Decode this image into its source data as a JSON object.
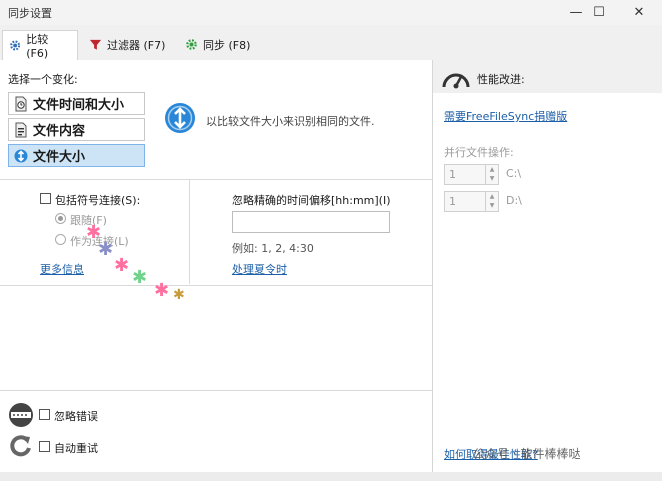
{
  "window": {
    "title": "同步设置",
    "controls": {
      "minimize": "—",
      "maximize": "☐",
      "close": "✕"
    }
  },
  "tabs": [
    {
      "label": "比较 (F6)",
      "icon": "gear-icon",
      "color": "#2f6fb6"
    },
    {
      "label": "过滤器 (F7)",
      "icon": "funnel-icon",
      "color": "#c0262d"
    },
    {
      "label": "同步 (F8)",
      "icon": "sync-gear-icon",
      "color": "#2e9e3f"
    }
  ],
  "compare": {
    "choose_label": "选择一个变化:",
    "variants": [
      {
        "label": "文件时间和大小",
        "icon": "clock-file-icon",
        "selected": false
      },
      {
        "label": "文件内容",
        "icon": "content-file-icon",
        "selected": false
      },
      {
        "label": "文件大小",
        "icon": "size-file-icon",
        "selected": true
      }
    ],
    "description": "以比较文件大小来识别相同的文件.",
    "symlinks": {
      "checkbox_label": "包括符号连接(S):",
      "follow_label": "跟随(F)",
      "as_link_label": "作为连接(L)",
      "more_info": "更多信息"
    },
    "time_shift": {
      "label": "忽略精确的时间偏移[hh:mm](I)",
      "value": "",
      "example": "例如: 1, 2, 4:30",
      "dst_link": "处理夏令时"
    },
    "ignore_errors": "忽略错误",
    "auto_retry": "自动重试"
  },
  "performance": {
    "title": "性能改进:",
    "donate_link": "需要FreeFileSync捐赠版",
    "parallel_label": "并行文件操作:",
    "drives": [
      {
        "value": "1",
        "drive": "C:\\"
      },
      {
        "value": "1",
        "drive": "D:\\"
      }
    ],
    "bottom_link": "如何取得最佳性能?",
    "watermark": "公众号 · 软件棒棒哒"
  },
  "colors": {
    "accent": "#1b5fa8",
    "selected_bg": "#cde4f7",
    "info_blue": "#2a87d8"
  }
}
